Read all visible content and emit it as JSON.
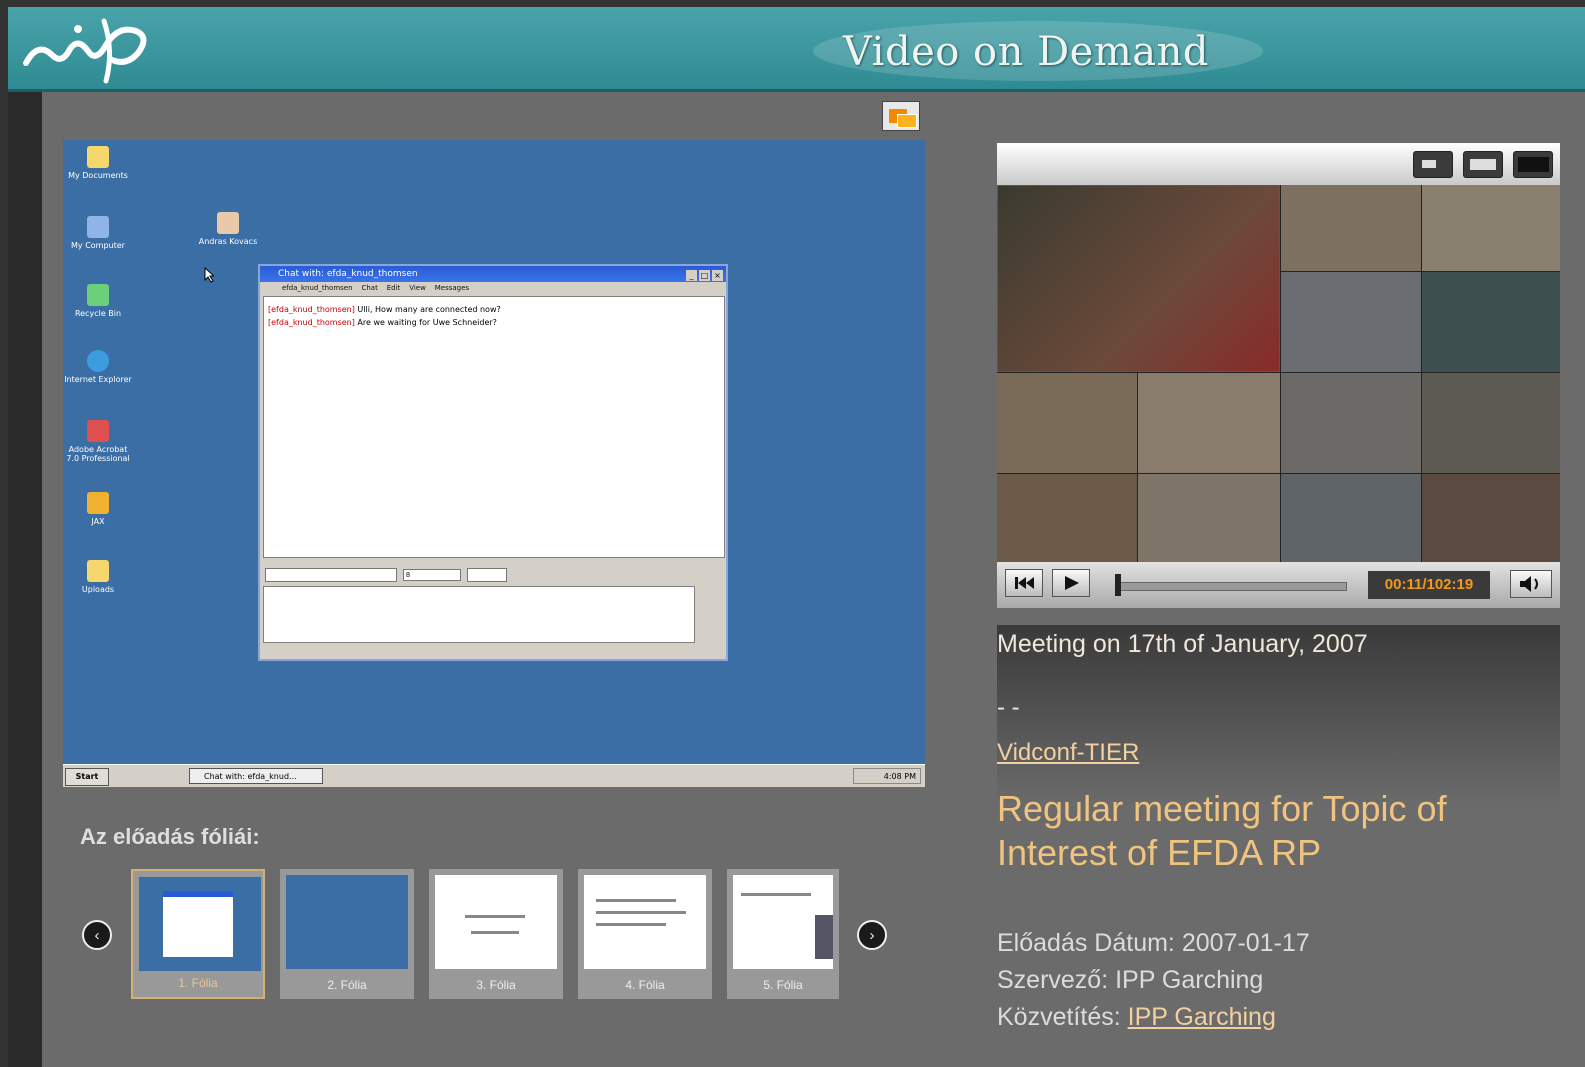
{
  "header": {
    "site_title": "Video on Demand",
    "logo_text": "niif"
  },
  "slide": {
    "desktop_icons": [
      {
        "label": "My Documents"
      },
      {
        "label": "My Computer"
      },
      {
        "label": "Andras Kovacs"
      },
      {
        "label": "Recycle Bin"
      },
      {
        "label": "Internet Explorer"
      },
      {
        "label": "Adobe Acrobat 7.0 Professional"
      },
      {
        "label": "JAX"
      },
      {
        "label": "Uploads"
      }
    ],
    "chat": {
      "title": "Chat with: efda_knud_thomsen",
      "menu": [
        "efda_knud_thomsen",
        "Chat",
        "Edit",
        "View",
        "Messages"
      ],
      "messages": [
        {
          "sender": "[efda_knud_thomsen]",
          "text": " Ulli, How many are connected now?"
        },
        {
          "sender": "[efda_knud_thomsen]",
          "text": " Are we waiting for Uwe Schneider?"
        }
      ],
      "font_size_value": "8"
    },
    "taskbar": {
      "start": "Start",
      "task": "Chat with: efda_knud...",
      "clock": "4:08 PM"
    }
  },
  "slides_section": {
    "heading": "Az előadás fóliái:",
    "thumbnails": [
      {
        "label": "1. Fólia",
        "selected": true
      },
      {
        "label": "2. Fólia",
        "selected": false
      },
      {
        "label": "3. Fólia",
        "selected": false
      },
      {
        "label": "4. Fólia",
        "selected": false
      },
      {
        "label": "5. Fólia",
        "selected": false
      }
    ]
  },
  "player": {
    "time": "00:11/102:19",
    "progress_fraction": 0.0018,
    "size_buttons": [
      "small-video-icon",
      "medium-video-icon",
      "large-video-icon"
    ]
  },
  "info": {
    "meeting_name": "Meeting on 17th of January, 2007",
    "dash": "- -",
    "group_link": "Vidconf-TIER",
    "talk_title": "Regular meeting for Topic of Interest of EFDA RP",
    "date_label": "Előadás Dátum: ",
    "date_value": "2007-01-17",
    "organizer_label": "Szervező: ",
    "organizer_value": "IPP Garching",
    "broadcast_label": "Közvetítés: ",
    "broadcast_link": "IPP Garching"
  },
  "colors": {
    "header_teal": "#2f8b93",
    "accent_orange": "#f29a1a",
    "title_gold": "#f0c480"
  }
}
